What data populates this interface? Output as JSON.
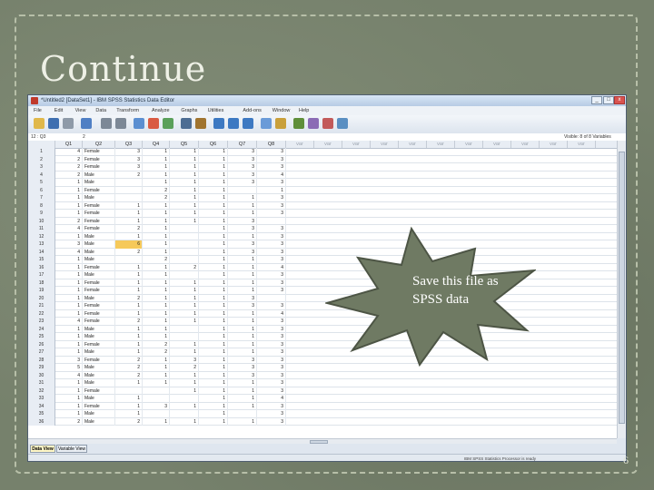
{
  "slide": {
    "title": "Continue",
    "page_number": "6"
  },
  "window": {
    "title": "*Untitled2 [DataSet1] - IBM SPSS Statistics Data Editor",
    "controls": {
      "minimize": "_",
      "maximize": "□",
      "close": "x"
    }
  },
  "menu": [
    "File",
    "Edit",
    "View",
    "Data",
    "Transform",
    "Analyze",
    "Graphs",
    "Utilities",
    "Add-ons",
    "Window",
    "Help"
  ],
  "cell_editor": {
    "ref": "12 : Q3",
    "value": "2"
  },
  "visible_label": "Visible: 8 of 8 Variables",
  "columns": [
    "Q1",
    "Q2",
    "Q3",
    "Q4",
    "Q5",
    "Q6",
    "Q7",
    "Q8",
    "var",
    "var",
    "var",
    "var",
    "var",
    "var",
    "var",
    "var",
    "var",
    "var",
    "var"
  ],
  "rows": [
    [
      "4",
      "Female",
      "3",
      "1",
      "1",
      "1",
      "3",
      "3"
    ],
    [
      "2",
      "Female",
      "3",
      "1",
      "1",
      "1",
      "3",
      "3"
    ],
    [
      "2",
      "Female",
      "3",
      "1",
      "1",
      "1",
      "3",
      "3"
    ],
    [
      "2",
      "Male",
      "2",
      "1",
      "1",
      "1",
      "3",
      "4"
    ],
    [
      "1",
      "Male",
      "",
      "1",
      "1",
      "1",
      "3",
      "3"
    ],
    [
      "1",
      "Female",
      "",
      "2",
      "1",
      "1",
      "",
      "1"
    ],
    [
      "1",
      "Male",
      "",
      "2",
      "1",
      "1",
      "1",
      "3"
    ],
    [
      "1",
      "Female",
      "1",
      "1",
      "1",
      "1",
      "1",
      "3"
    ],
    [
      "1",
      "Female",
      "1",
      "1",
      "1",
      "1",
      "1",
      "3"
    ],
    [
      "2",
      "Female",
      "1",
      "1",
      "1",
      "1",
      "3",
      ""
    ],
    [
      "4",
      "Female",
      "2",
      "1",
      "",
      "1",
      "3",
      "3"
    ],
    [
      "1",
      "Male",
      "1",
      "1",
      "",
      "1",
      "1",
      "3"
    ],
    [
      "3",
      "Male",
      "6",
      "1",
      "",
      "1",
      "3",
      "3"
    ],
    [
      "4",
      "Male",
      "2",
      "1",
      "",
      "1",
      "3",
      "3"
    ],
    [
      "1",
      "Male",
      "",
      "2",
      "",
      "1",
      "1",
      "3"
    ],
    [
      "1",
      "Female",
      "1",
      "1",
      "2",
      "1",
      "1",
      "4"
    ],
    [
      "1",
      "Male",
      "1",
      "1",
      "",
      "1",
      "1",
      "3"
    ],
    [
      "1",
      "Female",
      "1",
      "1",
      "1",
      "1",
      "1",
      "3"
    ],
    [
      "1",
      "Female",
      "1",
      "1",
      "1",
      "1",
      "1",
      "3"
    ],
    [
      "1",
      "Male",
      "2",
      "1",
      "1",
      "1",
      "3",
      ""
    ],
    [
      "1",
      "Female",
      "1",
      "1",
      "1",
      "1",
      "3",
      "3"
    ],
    [
      "1",
      "Female",
      "1",
      "1",
      "1",
      "1",
      "1",
      "4"
    ],
    [
      "4",
      "Female",
      "2",
      "1",
      "1",
      "1",
      "1",
      "3"
    ],
    [
      "1",
      "Male",
      "1",
      "1",
      "",
      "1",
      "1",
      "3"
    ],
    [
      "1",
      "Male",
      "1",
      "1",
      "",
      "1",
      "1",
      "3"
    ],
    [
      "1",
      "Female",
      "1",
      "2",
      "1",
      "1",
      "1",
      "3"
    ],
    [
      "1",
      "Male",
      "1",
      "2",
      "1",
      "1",
      "1",
      "3"
    ],
    [
      "3",
      "Female",
      "2",
      "1",
      "3",
      "1",
      "3",
      "3"
    ],
    [
      "5",
      "Male",
      "2",
      "1",
      "2",
      "1",
      "3",
      "3"
    ],
    [
      "4",
      "Male",
      "2",
      "1",
      "1",
      "1",
      "3",
      "3"
    ],
    [
      "1",
      "Male",
      "1",
      "1",
      "1",
      "1",
      "1",
      "3"
    ],
    [
      "1",
      "Female",
      "",
      "",
      "1",
      "1",
      "1",
      "3"
    ],
    [
      "1",
      "Male",
      "1",
      "",
      "",
      "1",
      "1",
      "4"
    ],
    [
      "1",
      "Female",
      "1",
      "3",
      "1",
      "1",
      "1",
      "3"
    ],
    [
      "1",
      "Male",
      "1",
      "",
      "",
      "1",
      "",
      "3"
    ],
    [
      "2",
      "Male",
      "2",
      "1",
      "1",
      "1",
      "1",
      "3"
    ]
  ],
  "selected_cell": {
    "row": 13,
    "col": 3
  },
  "tabs": {
    "data_view": "Data View",
    "variable_view": "Variable View"
  },
  "status": "IBM SPSS Statistics Processor is ready",
  "callout": {
    "text": "Save this file as SPSS data",
    "fill": "#6f7a63",
    "stroke": "#4d5545"
  },
  "colors": {
    "selection": "#f6c95a",
    "grid_header": "#e8edf4",
    "slide_bg": "#76816c"
  }
}
